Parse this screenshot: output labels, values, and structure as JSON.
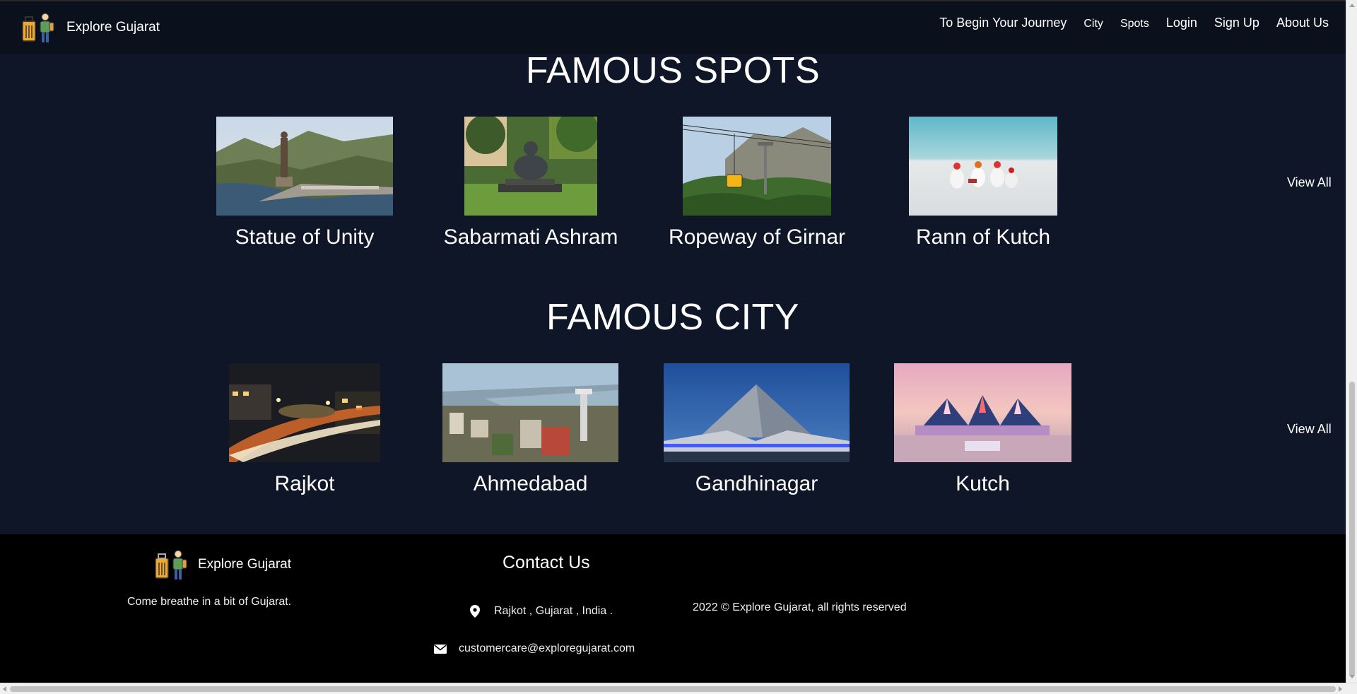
{
  "nav": {
    "brand": "Explore Gujarat",
    "links": [
      "To Begin Your Journey",
      "City",
      "Spots",
      "Login",
      "Sign Up",
      "About Us"
    ]
  },
  "spots": {
    "title": "FAMOUS SPOTS",
    "view_all": "View All",
    "items": [
      {
        "name": "Statue of Unity",
        "icon": "statue-of-unity-photo"
      },
      {
        "name": "Sabarmati Ashram",
        "icon": "sabarmati-ashram-photo"
      },
      {
        "name": "Ropeway of Girnar",
        "icon": "girnar-ropeway-photo"
      },
      {
        "name": "Rann of Kutch",
        "icon": "rann-of-kutch-photo"
      }
    ]
  },
  "cities": {
    "title": "FAMOUS CITY",
    "view_all": "View All",
    "items": [
      {
        "name": "Rajkot",
        "icon": "rajkot-photo"
      },
      {
        "name": "Ahmedabad",
        "icon": "ahmedabad-photo"
      },
      {
        "name": "Gandhinagar",
        "icon": "gandhinagar-photo"
      },
      {
        "name": "Kutch",
        "icon": "kutch-photo"
      }
    ]
  },
  "footer": {
    "brand": "Explore Gujarat",
    "tagline": "Come breathe in a bit of Gujarat.",
    "contact_title": "Contact Us",
    "address": "Rajkot , Gujarat , India .",
    "email": "customercare@exploregujarat.com",
    "copyright": "2022 © Explore Gujarat, all rights reserved"
  },
  "colors": {
    "page_bg": "#0e1628",
    "navbar_bg": "#0b111c",
    "footer_bg": "#000000",
    "text": "#ffffff"
  }
}
